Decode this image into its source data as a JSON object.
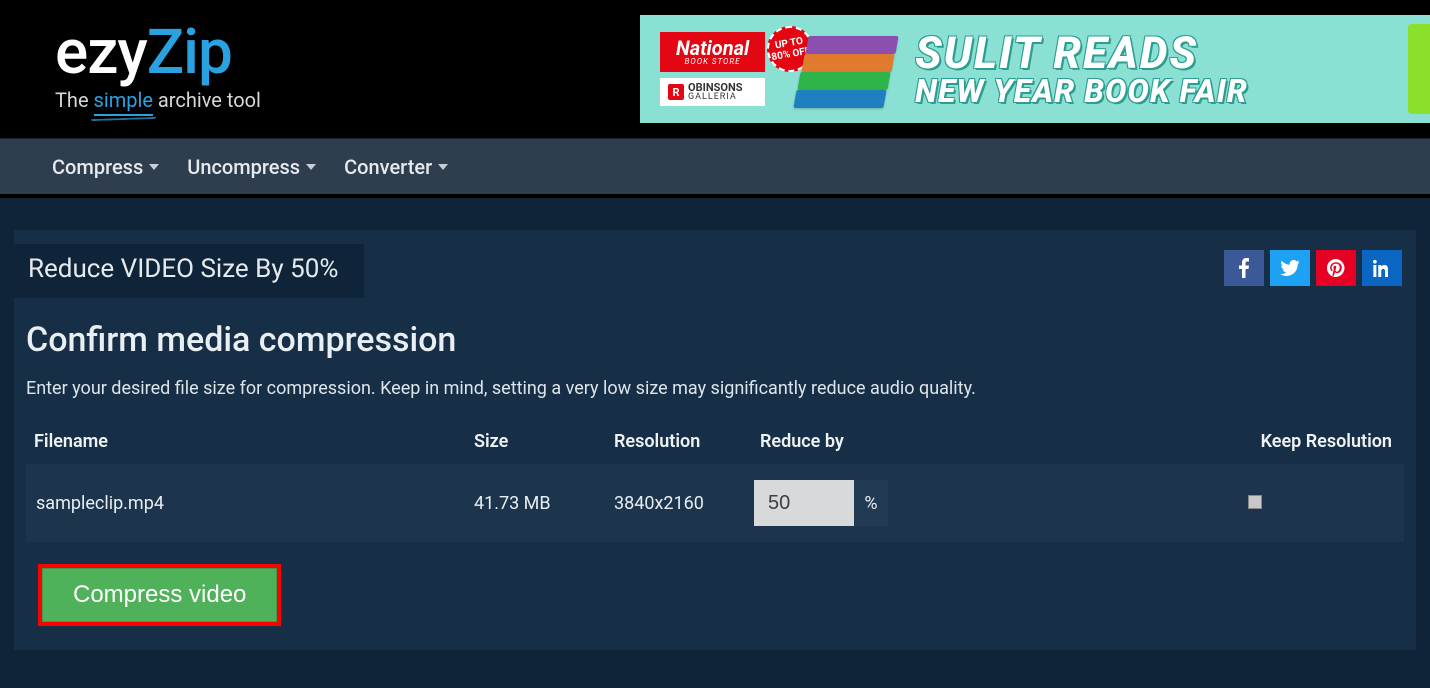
{
  "logo": {
    "part1": "ezy",
    "part2": "Zip",
    "tag_pre": "The ",
    "tag_simple": "simple",
    "tag_post": " archive tool"
  },
  "ad": {
    "badge1": "National",
    "badge1_sub": "BOOK STORE",
    "badge2_pre": "R",
    "badge2_name": "OBINSONS",
    "badge2_sub": "GALLERIA",
    "sticker": "UP TO 80% OFF",
    "line1": "SULIT READS",
    "line2": "NEW YEAR BOOK FAIR"
  },
  "nav": [
    {
      "label": "Compress"
    },
    {
      "label": "Uncompress"
    },
    {
      "label": "Converter"
    }
  ],
  "tab_title": "Reduce VIDEO Size By 50%",
  "section_title": "Confirm media compression",
  "section_desc": "Enter your desired file size for compression. Keep in mind, setting a very low size may significantly reduce audio quality.",
  "table": {
    "headers": {
      "filename": "Filename",
      "size": "Size",
      "resolution": "Resolution",
      "reduce": "Reduce by",
      "keep": "Keep Resolution"
    },
    "row": {
      "filename": "sampleclip.mp4",
      "size": "41.73 MB",
      "resolution": "3840x2160",
      "reduce_value": "50",
      "pct": "%"
    }
  },
  "cta_label": "Compress video",
  "social": {
    "fb": "f",
    "tw": "tw",
    "pi": "pi",
    "li": "in"
  }
}
